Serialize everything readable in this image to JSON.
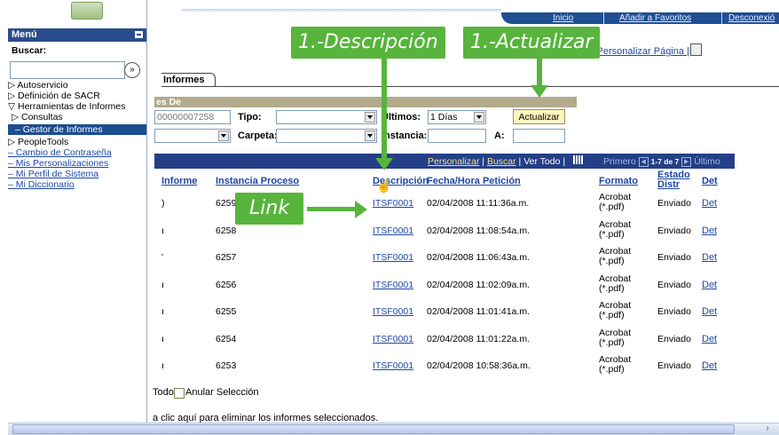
{
  "topnav": {
    "inicio": "Inicio",
    "favoritos": "Añadir a Favoritos",
    "desconexion": "Desconexió"
  },
  "header": {
    "links_text": "Nueva Ventana | Ayuda | Personalizar Página |",
    "print_icon": "print-page-icon"
  },
  "menu": {
    "title": "Menú",
    "search_label": "Buscar:",
    "search_value": "",
    "search_button": "»",
    "items": [
      {
        "label": "▷ Autoservicio",
        "type": "folder"
      },
      {
        "label": "▷ Definición de SACR",
        "type": "folder"
      },
      {
        "label": "▽ Herramientas de Informes",
        "type": "folder"
      },
      {
        "label": "▷ Consultas",
        "type": "subfolder"
      },
      {
        "label": "– Gestor de Informes",
        "type": "selected"
      },
      {
        "label": "▷ PeopleTools",
        "type": "folder"
      },
      {
        "label": "– Cambio de Contraseña",
        "type": "link"
      },
      {
        "label": "– Mis Personalizaciones",
        "type": "link"
      },
      {
        "label": "– Mi Perfil de Sistema",
        "type": "link"
      },
      {
        "label": "– Mi Diccionario",
        "type": "link"
      }
    ]
  },
  "tab": {
    "label": "Informes"
  },
  "filters": {
    "section_title": "es De",
    "id_value": "00000007258",
    "tipo_label": "Tipo:",
    "ultimos_label": "Últimos:",
    "ultimos_value": "1",
    "unit_value": "Días",
    "actualizar_button": "Actualizar",
    "carpeta_label": "Carpeta:",
    "instancia_label": "Instancia:",
    "a_label": "A:"
  },
  "grid": {
    "links": [
      "Personalizar",
      "Buscar",
      "Ver Todo"
    ],
    "pager": {
      "first": "Primero",
      "range": "1-7 de 7",
      "last": "Último"
    },
    "columns": {
      "informe": "Informe",
      "instancia": "Instancia Proceso",
      "descripcion": "Descripción",
      "fecha": "Fecha/Hora Petición",
      "formato": "Formato",
      "estado": "Estado Distr",
      "det": "Det"
    },
    "rows": [
      {
        "mark": ")",
        "instancia": "6259",
        "descripcion": "ITSF0001",
        "fecha": "02/04/2008 11:11:36a.m.",
        "formato": "Acrobat (*.pdf)",
        "estado": "Enviado",
        "det": "Det"
      },
      {
        "mark": "ı",
        "instancia": "6258",
        "descripcion": "ITSF0001",
        "fecha": "02/04/2008 11:08:54a.m.",
        "formato": "Acrobat (*.pdf)",
        "estado": "Enviado",
        "det": "Det"
      },
      {
        "mark": "'",
        "instancia": "6257",
        "descripcion": "ITSF0001",
        "fecha": "02/04/2008 11:06:43a.m.",
        "formato": "Acrobat (*.pdf)",
        "estado": "Enviado",
        "det": "Det"
      },
      {
        "mark": "ı",
        "instancia": "6256",
        "descripcion": "ITSF0001",
        "fecha": "02/04/2008 11:02:09a.m.",
        "formato": "Acrobat (*.pdf)",
        "estado": "Enviado",
        "det": "Det"
      },
      {
        "mark": "ı",
        "instancia": "6255",
        "descripcion": "ITSF0001",
        "fecha": "02/04/2008 11:01:41a.m.",
        "formato": "Acrobat (*.pdf)",
        "estado": "Enviado",
        "det": "Det"
      },
      {
        "mark": "ı",
        "instancia": "6254",
        "descripcion": "ITSF0001",
        "fecha": "02/04/2008 11:01:22a.m.",
        "formato": "Acrobat (*.pdf)",
        "estado": "Enviado",
        "det": "Det"
      },
      {
        "mark": "ı",
        "instancia": "6253",
        "descripcion": "ITSF0001",
        "fecha": "02/04/2008 10:58:36a.m.",
        "formato": "Acrobat (*.pdf)",
        "estado": "Enviado",
        "det": "Det"
      }
    ]
  },
  "footer": {
    "select_all": "Todo",
    "deselect": "Anular Selección",
    "delete_hint": "a clic aquí para eliminar los informes seleccionados."
  },
  "annotations": {
    "descripcion": "1.-Descripción",
    "actualizar": "1.-Actualizar",
    "link": "Link",
    "color": "#58b43c"
  }
}
